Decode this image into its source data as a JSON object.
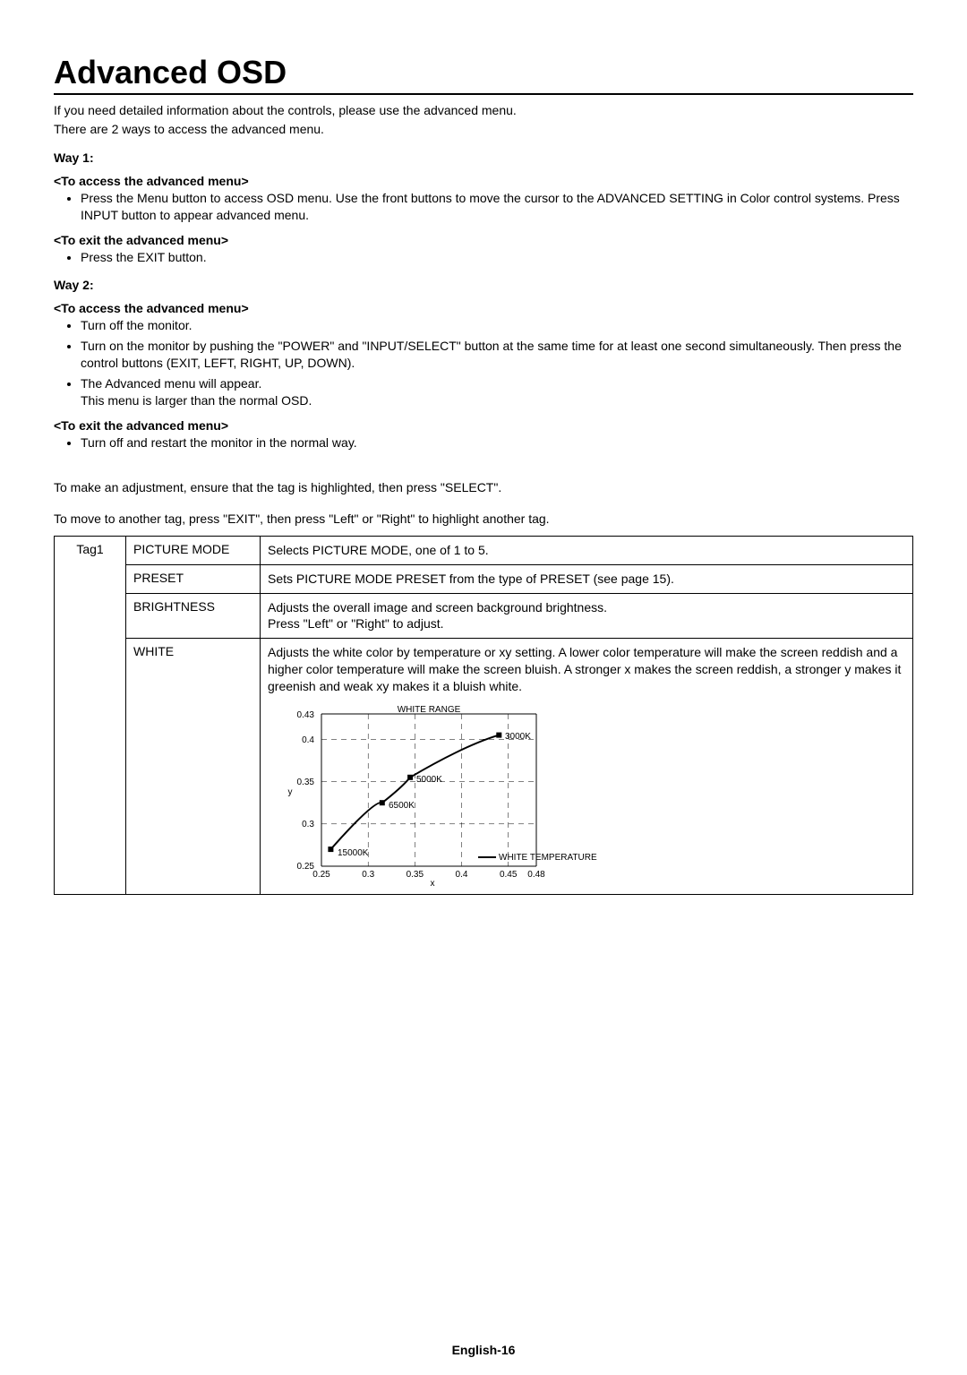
{
  "title": "Advanced OSD",
  "intro_line1": "If you need detailed information about the controls, please use the advanced menu.",
  "intro_line2": "There are 2 ways to access the advanced menu.",
  "way1": {
    "label": "Way 1:",
    "access_head": "<To access the advanced menu>",
    "access_bullets": [
      "Press the Menu button to access OSD menu. Use the front buttons to move the cursor to the ADVANCED SETTING in Color control systems. Press INPUT button to appear advanced menu."
    ],
    "exit_head": "<To exit the advanced menu>",
    "exit_bullets": [
      "Press the EXIT button."
    ]
  },
  "way2": {
    "label": "Way 2:",
    "access_head": "<To access the advanced menu>",
    "access_bullets": [
      "Turn off the monitor.",
      "Turn on the monitor by pushing the \"POWER\" and \"INPUT/SELECT\" button at the same time for at least one second simultaneously. Then press the control buttons (EXIT, LEFT, RIGHT, UP, DOWN).",
      "The Advanced menu will appear.\nThis menu is larger than the normal OSD."
    ],
    "exit_head": "<To exit the advanced menu>",
    "exit_bullets": [
      "Turn off and restart the monitor in the normal way."
    ]
  },
  "adjust_line": "To make an adjustment, ensure that the tag is highlighted, then press \"SELECT\".",
  "move_line": "To move to another tag, press \"EXIT\", then press \"Left\" or \"Right\" to highlight another tag.",
  "table": {
    "tag": "Tag1",
    "rows": [
      {
        "name": "PICTURE MODE",
        "desc": "Selects PICTURE MODE, one of 1 to 5."
      },
      {
        "name": "PRESET",
        "desc": "Sets PICTURE MODE PRESET from the type of PRESET (see page 15)."
      },
      {
        "name": "BRIGHTNESS",
        "desc": "Adjusts the overall image and screen background brightness.\nPress \"Left\" or \"Right\" to adjust."
      },
      {
        "name": "WHITE",
        "desc": "Adjusts the white color by temperature or xy setting. A lower color temperature will make the screen reddish and a higher color temperature will make the screen bluish. A stronger x makes the screen reddish, a stronger y makes it greenish and weak xy makes it a bluish white."
      }
    ]
  },
  "chart_data": {
    "type": "line",
    "title": "WHITE RANGE",
    "xlabel": "x",
    "ylabel": "y",
    "xlim": [
      0.25,
      0.48
    ],
    "ylim": [
      0.25,
      0.43
    ],
    "x_ticks": [
      0.25,
      0.3,
      0.35,
      0.4,
      0.45,
      0.48
    ],
    "y_ticks": [
      0.25,
      0.3,
      0.35,
      0.4,
      0.43
    ],
    "series": [
      {
        "name": "WHITE TEMPERATURE",
        "values": [
          {
            "x": 0.26,
            "y": 0.27,
            "label": "15000K"
          },
          {
            "x": 0.315,
            "y": 0.325,
            "label": "6500K"
          },
          {
            "x": 0.345,
            "y": 0.355,
            "label": "5000K"
          },
          {
            "x": 0.44,
            "y": 0.405,
            "label": "3000K"
          }
        ]
      }
    ],
    "legend": "WHITE TEMPERATURE"
  },
  "footer": "English-16"
}
